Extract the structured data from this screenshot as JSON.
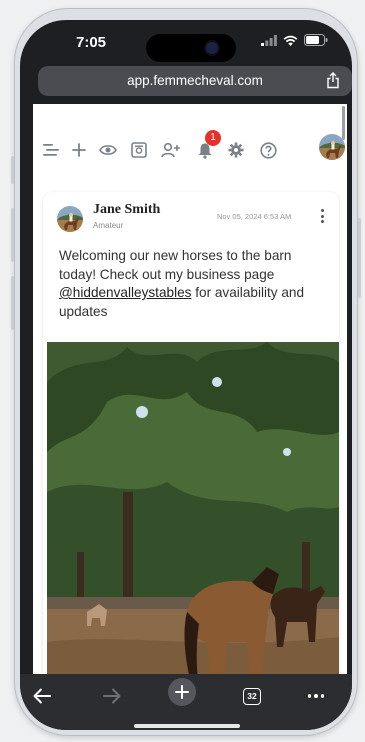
{
  "status_bar": {
    "time": "7:05"
  },
  "browser": {
    "url": "app.femmecheval.com",
    "tab_count": "32"
  },
  "toolbar": {
    "notification_count": "1",
    "icons": [
      "menu-icon",
      "add-icon",
      "eye-icon",
      "gallery-icon",
      "add-user-icon",
      "bell-icon",
      "gear-icon",
      "help-icon",
      "profile-avatar"
    ]
  },
  "post": {
    "author": "Jane Smith",
    "role": "Amateur",
    "date": "Nov 05, 2024 6:53 AM",
    "text_before": "Welcoming our new horses to the barn today! Check out my business page ",
    "mention": "@hiddenvalleystables",
    "text_after": " for availability and updates"
  },
  "colors": {
    "badge": "#e4322b",
    "browser_chrome": "#2c2d31",
    "url_bar": "#4a4c51"
  }
}
